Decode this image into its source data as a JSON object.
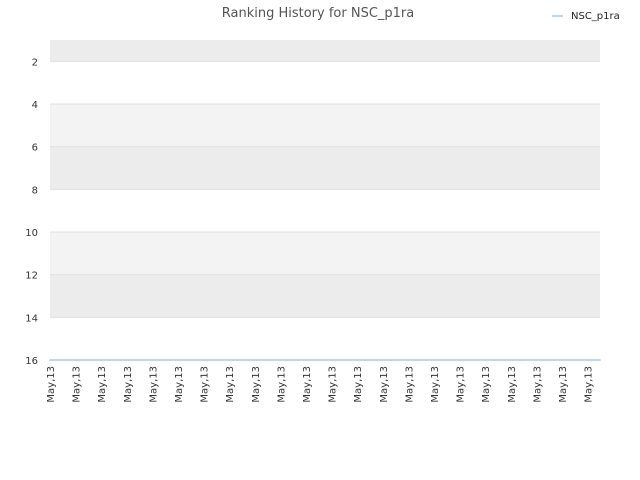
{
  "chart_data": {
    "type": "line",
    "title": "Ranking History for NSC_p1ra",
    "xlabel": "",
    "ylabel": "",
    "categories": [
      "May,13",
      "May,13",
      "May,13",
      "May,13",
      "May,13",
      "May,13",
      "May,13",
      "May,13",
      "May,13",
      "May,13",
      "May,13",
      "May,13",
      "May,13",
      "May,13",
      "May,13",
      "May,13",
      "May,13",
      "May,13",
      "May,13",
      "May,13",
      "May,13",
      "May,13"
    ],
    "series": [
      {
        "name": "NSC_p1ra",
        "color": "#a8c8e8",
        "values": [
          16,
          16,
          16,
          16,
          16,
          16,
          16,
          16,
          16,
          16,
          16,
          16,
          16,
          16,
          16,
          16,
          16,
          16,
          16,
          16,
          16,
          16
        ]
      }
    ],
    "y_ticks": [
      2,
      4,
      6,
      8,
      10,
      12,
      14,
      16
    ],
    "ylim": [
      1,
      16
    ],
    "y_inverted": true,
    "grid": true,
    "band_colors": [
      "#ececec",
      "#ffffff",
      "#f3f3f3"
    ],
    "legend_position": "top-right"
  }
}
